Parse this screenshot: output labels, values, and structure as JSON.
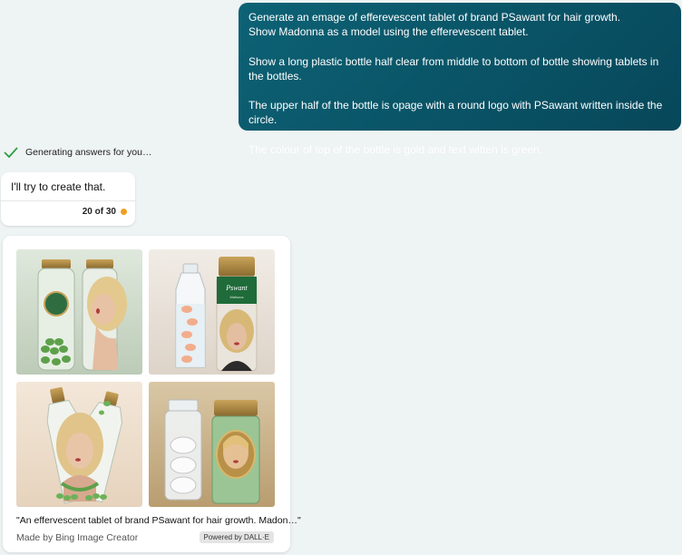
{
  "user_message": {
    "lines": [
      "Generate an emage of  efferevescent tablet of brand PSawant for hair growth.",
      "Show Madonna as a model using the efferevescent tablet.",
      "",
      "Show a long plastic bottle half clear from middle to bottom of bottle showing tablets in the bottles.",
      "",
      "The upper half of the bottle is opage with a round logo with PSawant written inside the circle.",
      "",
      "The colour of top of the bottle is gold and text witten is green."
    ]
  },
  "status": {
    "text": "Generating answers for you…",
    "icon": "checkmark-icon",
    "color": "#2e9e44"
  },
  "bot_reply": {
    "text": "I'll try to create that.",
    "counter": "20 of 30",
    "counter_color": "#f0a020"
  },
  "image_card": {
    "images": [
      {
        "name": "generated-image-1",
        "label_text": "PSawant"
      },
      {
        "name": "generated-image-2",
        "label_text": "Pswant",
        "sub_text": "Malsoca"
      },
      {
        "name": "generated-image-3"
      },
      {
        "name": "generated-image-4"
      }
    ],
    "caption": "\"An effervescent tablet of brand PSawant for hair growth. Madon…\"",
    "made_by": "Made by Bing Image Creator",
    "powered_by": "Powered by DALL·E"
  },
  "colors": {
    "user_bubble": "#07475a",
    "page_bg": "#eef3f3"
  }
}
